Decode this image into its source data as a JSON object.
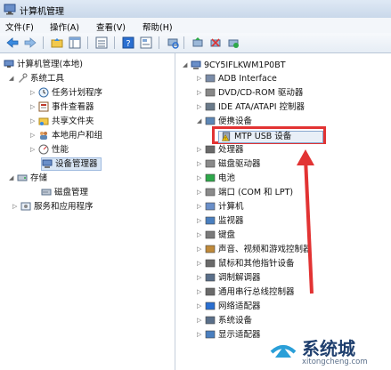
{
  "window": {
    "title": "计算机管理",
    "icon": "computer-management-icon"
  },
  "menu": [
    "文件(F)",
    "操作(A)",
    "查看(V)",
    "帮助(H)"
  ],
  "toolbar": [
    "back-arrow-icon",
    "forward-arrow-icon",
    "up-folder-icon",
    "show-tree-icon",
    "list-icon",
    "help-icon",
    "properties-icon",
    "scan-hardware-icon",
    "update-driver-icon",
    "disable-icon",
    "uninstall-icon"
  ],
  "left_tree": {
    "root": "计算机管理(本地)",
    "system_tools": "系统工具",
    "items": [
      "任务计划程序",
      "事件查看器",
      "共享文件夹",
      "本地用户和组",
      "性能",
      "设备管理器"
    ],
    "storage": "存储",
    "disk": "磁盘管理",
    "services": "服务和应用程序"
  },
  "right_tree": {
    "computer": "9CY5IFLKWM1P0BT",
    "categories": [
      "ADB Interface",
      "DVD/CD-ROM 驱动器",
      "IDE ATA/ATAPI 控制器",
      "便携设备",
      "处理器",
      "磁盘驱动器",
      "电池",
      "端口 (COM 和 LPT)",
      "计算机",
      "监视器",
      "键盘",
      "声音、视频和游戏控制器",
      "鼠标和其他指针设备",
      "调制解调器",
      "通用串行总线控制器",
      "网络适配器",
      "系统设备",
      "显示适配器"
    ],
    "mtp_device": "MTP USB 设备"
  },
  "watermark": {
    "text": "系统城",
    "url": "xitongcheng.com"
  },
  "colors": {
    "highlight_box": "#e23333",
    "accent": "#2a6fd1"
  }
}
